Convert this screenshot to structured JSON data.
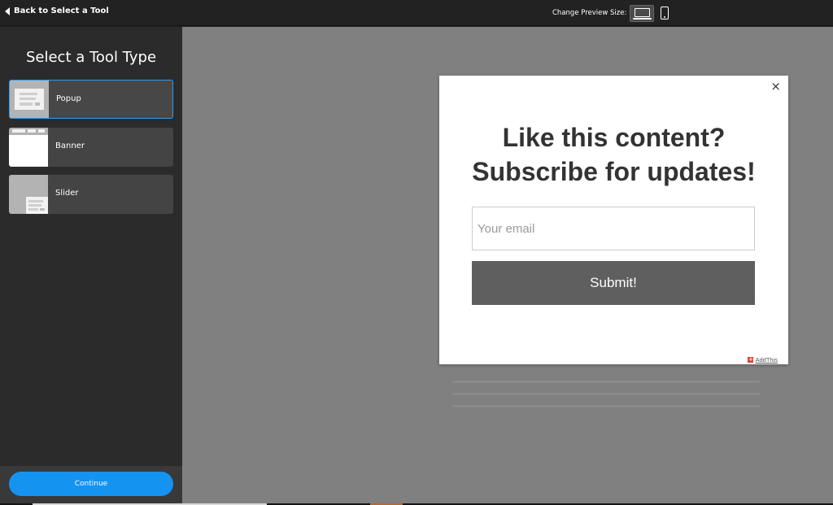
{
  "topbar": {
    "back_label": "Back to Select a Tool",
    "preview_size_label": "Change Preview Size:",
    "desktop_icon": "laptop-icon",
    "mobile_icon": "mobile-icon"
  },
  "sidebar": {
    "title": "Select a Tool Type",
    "tools": [
      {
        "label": "Popup",
        "icon": "popup-thumbnail",
        "selected": true
      },
      {
        "label": "Banner",
        "icon": "banner-thumbnail",
        "selected": false
      },
      {
        "label": "Slider",
        "icon": "slider-thumbnail",
        "selected": false
      }
    ],
    "continue_label": "Continue"
  },
  "popup": {
    "close_symbol": "×",
    "heading_line1": "Like this content?",
    "heading_line2": "Subscribe for updates!",
    "email_placeholder": "Your email",
    "submit_label": "Submit!",
    "brand_plus": "+",
    "brand_label": "AddThis"
  },
  "colors": {
    "accent": "#1493f0",
    "sidebar_bg": "#2b2b2b",
    "preview_bg": "#808080",
    "submit_bg": "#5f5f5f",
    "brand_red": "#e33b2e"
  }
}
